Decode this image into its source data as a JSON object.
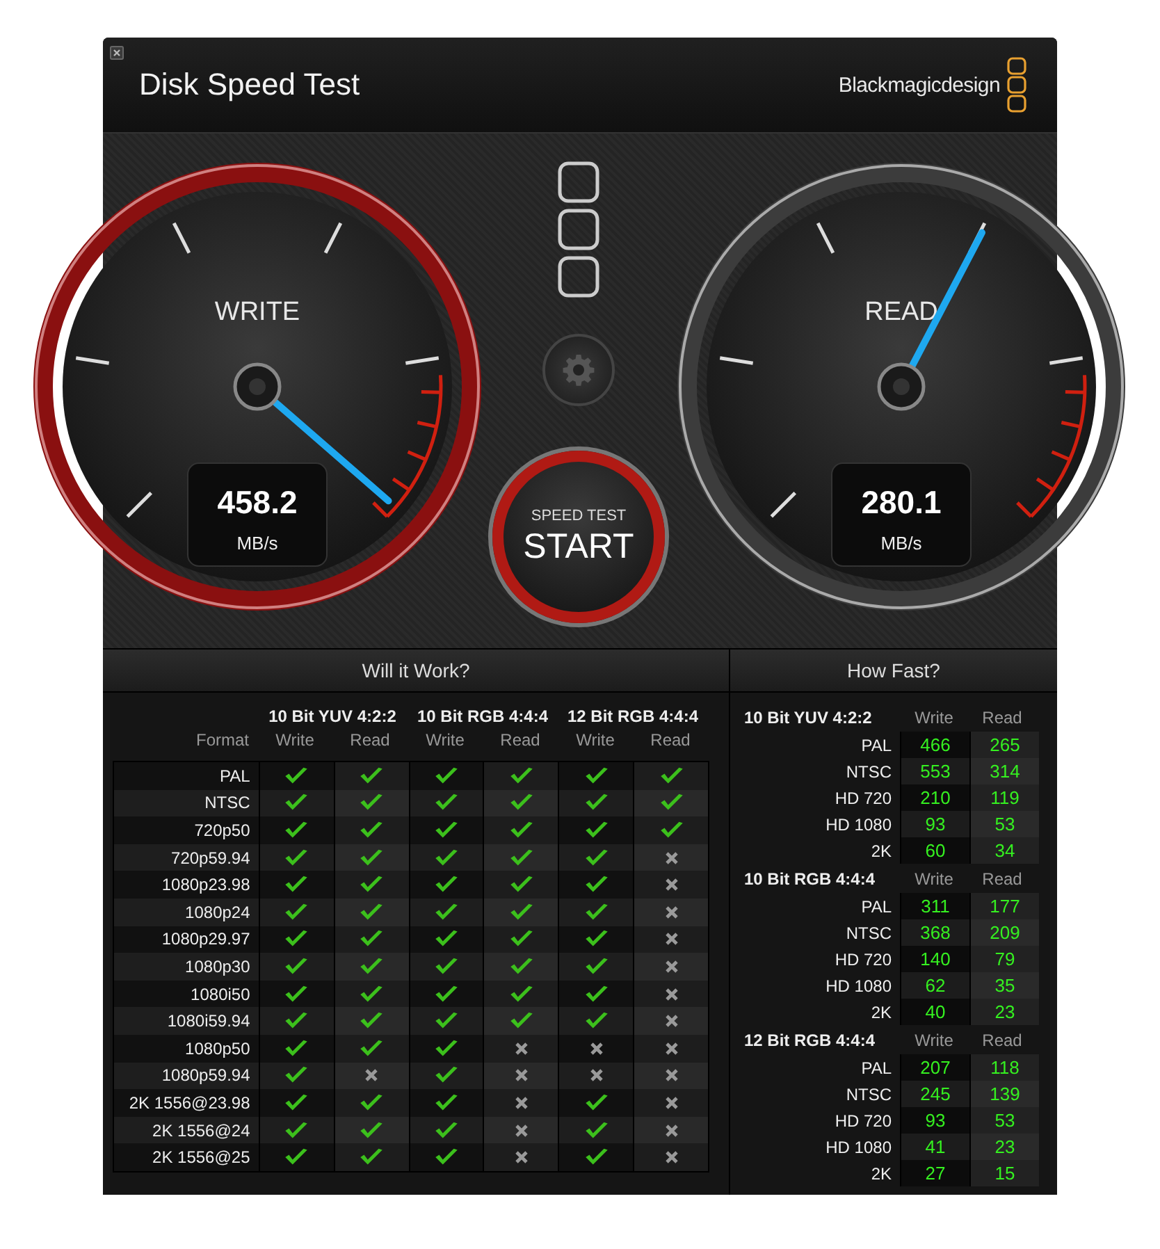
{
  "window": {
    "title": "Disk Speed Test",
    "brand": "Blackmagicdesign"
  },
  "gauges": [
    {
      "label": "WRITE",
      "value": "458.2",
      "unit": "MB/s",
      "active": true
    },
    {
      "label": "READ",
      "value": "280.1",
      "unit": "MB/s",
      "active": false
    }
  ],
  "start_button": {
    "caption": "SPEED TEST",
    "label": "START"
  },
  "will_it_work": {
    "title": "Will it Work?",
    "format_header": "Format",
    "groups": [
      {
        "name": "10 Bit YUV 4:2:2",
        "columns": [
          "Write",
          "Read"
        ]
      },
      {
        "name": "10 Bit RGB 4:4:4",
        "columns": [
          "Write",
          "Read"
        ]
      },
      {
        "name": "12 Bit RGB 4:4:4",
        "columns": [
          "Write",
          "Read"
        ]
      }
    ],
    "rows": [
      {
        "format": "PAL",
        "results": [
          true,
          true,
          true,
          true,
          true,
          true
        ]
      },
      {
        "format": "NTSC",
        "results": [
          true,
          true,
          true,
          true,
          true,
          true
        ]
      },
      {
        "format": "720p50",
        "results": [
          true,
          true,
          true,
          true,
          true,
          true
        ]
      },
      {
        "format": "720p59.94",
        "results": [
          true,
          true,
          true,
          true,
          true,
          false
        ]
      },
      {
        "format": "1080p23.98",
        "results": [
          true,
          true,
          true,
          true,
          true,
          false
        ]
      },
      {
        "format": "1080p24",
        "results": [
          true,
          true,
          true,
          true,
          true,
          false
        ]
      },
      {
        "format": "1080p29.97",
        "results": [
          true,
          true,
          true,
          true,
          true,
          false
        ]
      },
      {
        "format": "1080p30",
        "results": [
          true,
          true,
          true,
          true,
          true,
          false
        ]
      },
      {
        "format": "1080i50",
        "results": [
          true,
          true,
          true,
          true,
          true,
          false
        ]
      },
      {
        "format": "1080i59.94",
        "results": [
          true,
          true,
          true,
          true,
          true,
          false
        ]
      },
      {
        "format": "1080p50",
        "results": [
          true,
          true,
          true,
          false,
          false,
          false
        ]
      },
      {
        "format": "1080p59.94",
        "results": [
          true,
          false,
          true,
          false,
          false,
          false
        ]
      },
      {
        "format": "2K 1556@23.98",
        "results": [
          true,
          true,
          true,
          false,
          true,
          false
        ]
      },
      {
        "format": "2K 1556@24",
        "results": [
          true,
          true,
          true,
          false,
          true,
          false
        ]
      },
      {
        "format": "2K 1556@25",
        "results": [
          true,
          true,
          true,
          false,
          true,
          false
        ]
      }
    ]
  },
  "how_fast": {
    "title": "How Fast?",
    "groups": [
      {
        "name": "10 Bit YUV 4:2:2",
        "columns": [
          "Write",
          "Read"
        ],
        "rows": [
          {
            "format": "PAL",
            "values": [
              "466",
              "265"
            ]
          },
          {
            "format": "NTSC",
            "values": [
              "553",
              "314"
            ]
          },
          {
            "format": "HD 720",
            "values": [
              "210",
              "119"
            ]
          },
          {
            "format": "HD 1080",
            "values": [
              "93",
              "53"
            ]
          },
          {
            "format": "2K",
            "values": [
              "60",
              "34"
            ]
          }
        ]
      },
      {
        "name": "10 Bit RGB 4:4:4",
        "columns": [
          "Write",
          "Read"
        ],
        "rows": [
          {
            "format": "PAL",
            "values": [
              "311",
              "177"
            ]
          },
          {
            "format": "NTSC",
            "values": [
              "368",
              "209"
            ]
          },
          {
            "format": "HD 720",
            "values": [
              "140",
              "79"
            ]
          },
          {
            "format": "HD 1080",
            "values": [
              "62",
              "35"
            ]
          },
          {
            "format": "2K",
            "values": [
              "40",
              "23"
            ]
          }
        ]
      },
      {
        "name": "12 Bit RGB 4:4:4",
        "columns": [
          "Write",
          "Read"
        ],
        "rows": [
          {
            "format": "PAL",
            "values": [
              "207",
              "118"
            ]
          },
          {
            "format": "NTSC",
            "values": [
              "245",
              "139"
            ]
          },
          {
            "format": "HD 720",
            "values": [
              "93",
              "53"
            ]
          },
          {
            "format": "HD 1080",
            "values": [
              "41",
              "23"
            ]
          },
          {
            "format": "2K",
            "values": [
              "27",
              "15"
            ]
          }
        ]
      }
    ]
  }
}
